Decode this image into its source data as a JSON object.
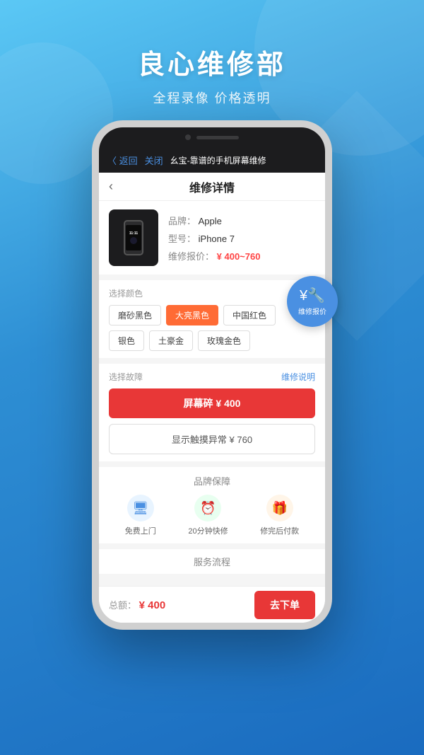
{
  "header": {
    "main_title": "良心维修部",
    "sub_title": "全程录像 价格透明"
  },
  "nav": {
    "back_label": "〈 返回",
    "close_label": "关闭",
    "nav_title": "幺宝-靠谱的手机屏幕维修"
  },
  "page_title": "维修详情",
  "product": {
    "brand_label": "品牌：",
    "brand_value": "Apple",
    "model_label": "型号：",
    "model_value": "iPhone 7",
    "price_label": "维修报价：",
    "price_value": "¥ 400~760"
  },
  "colors": {
    "section_label": "选择颜色",
    "items": [
      {
        "label": "磨砂黑色",
        "active": false
      },
      {
        "label": "大亮黑色",
        "active": true
      },
      {
        "label": "中国红色",
        "active": false
      },
      {
        "label": "银色",
        "active": false
      },
      {
        "label": "土豪金",
        "active": false
      },
      {
        "label": "玫瑰金色",
        "active": false
      }
    ]
  },
  "faults": {
    "section_label": "选择故障",
    "repair_link": "维修说明",
    "items": [
      {
        "label": "屏幕碎 ¥ 400",
        "active": true
      },
      {
        "label": "显示触摸异常 ¥ 760",
        "active": false
      }
    ]
  },
  "guarantee": {
    "title": "品牌保障",
    "items": [
      {
        "icon": "🖥",
        "text": "免费上门"
      },
      {
        "icon": "⏰",
        "text": "20分钟快修"
      },
      {
        "icon": "🎁",
        "text": "修完后付款"
      }
    ]
  },
  "service": {
    "title": "服务流程"
  },
  "bottom": {
    "total_label": "总额：",
    "total_price": "¥ 400",
    "order_btn": "去下单"
  },
  "float_badge": {
    "icon": "¥",
    "text": "维修报价"
  }
}
